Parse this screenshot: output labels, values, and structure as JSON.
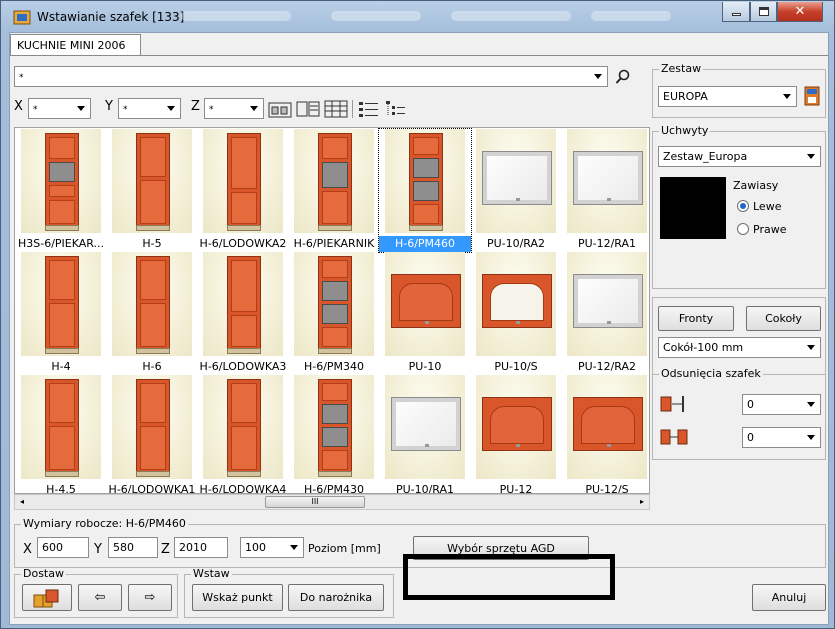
{
  "window": {
    "title": "Wstawianie szafek [133]"
  },
  "tab": {
    "label": "KUCHNIE MINI 2006"
  },
  "filter": {
    "value": "*",
    "x_label": "X",
    "x_value": "*",
    "y_label": "Y",
    "y_value": "*",
    "z_label": "Z",
    "z_value": "*"
  },
  "zestaw": {
    "label": "Zestaw",
    "value": "EUROPA"
  },
  "uchwyty": {
    "label": "Uchwyty",
    "value": "Zestaw_Europa",
    "zawiasy_label": "Zawiasy",
    "lewe": "Lewe",
    "prawe": "Prawe"
  },
  "fronts": {
    "fronty": "Fronty",
    "cokoly": "Cokoły",
    "cokol_value": "Cokół-100 mm"
  },
  "odsuniecia": {
    "label": "Odsunięcia szafek",
    "val1": "0",
    "val2": "0"
  },
  "cells": [
    "H3S-6/PIEKAR...",
    "H-5",
    "H-6/LODOWKA2",
    "H-6/PIEKARNIK",
    "H-6/PM460",
    "PU-10/RA2",
    "PU-12/RA1",
    "H-4",
    "H-6",
    "H-6/LODOWKA3",
    "H-6/PM340",
    "PU-10",
    "PU-10/S",
    "PU-12/RA2",
    "H-4.5",
    "H-6/LODOWKA1",
    "H-6/LODOWKA4",
    "H-6/PM430",
    "PU-10/RA1",
    "PU-12",
    "PU-12/S"
  ],
  "scroll": {
    "thumb": "III"
  },
  "wymiary": {
    "label": "Wymiary robocze: H-6/PM460",
    "x_label": "X",
    "x": "600",
    "y_label": "Y",
    "y": "580",
    "z_label": "Z",
    "z": "2010",
    "poziom_value": "100",
    "poziom_label": "Poziom [mm]",
    "agd_button": "Wybór sprzętu AGD"
  },
  "dostaw": {
    "label": "Dostaw",
    "left": "⇦",
    "right": "⇨"
  },
  "wstaw": {
    "label": "Wstaw",
    "wskaz": "Wskaż punkt",
    "naroznik": "Do narożnika"
  },
  "anuluj": "Anuluj",
  "colors": {
    "front_orange": "#d9562a",
    "selection": "#3399ff",
    "highlight_frame": "#000000"
  }
}
